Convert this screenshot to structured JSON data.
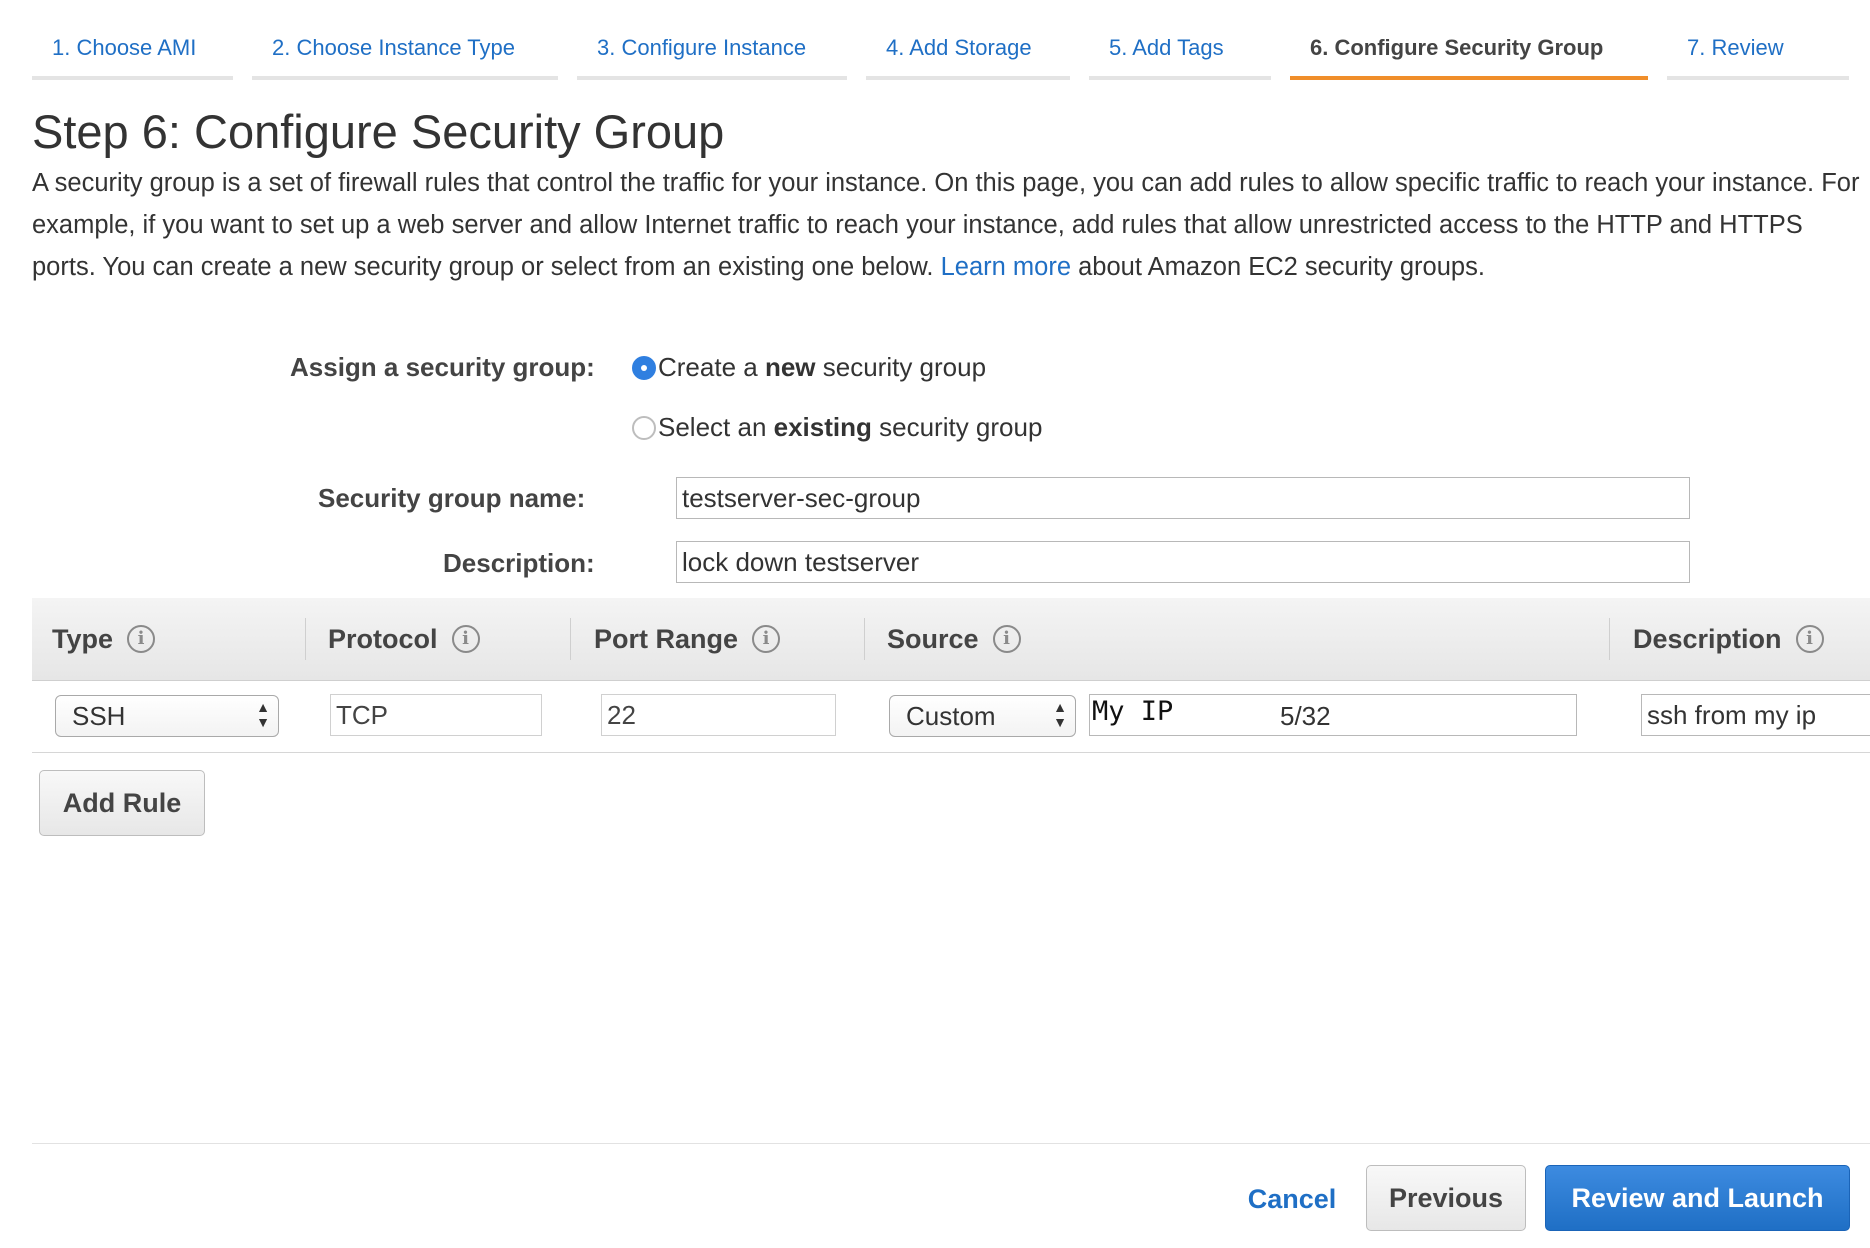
{
  "wizard": {
    "tabs": [
      {
        "label": "1. Choose AMI"
      },
      {
        "label": "2. Choose Instance Type"
      },
      {
        "label": "3. Configure Instance"
      },
      {
        "label": "4. Add Storage"
      },
      {
        "label": "5. Add Tags"
      },
      {
        "label": "6. Configure Security Group",
        "active": true
      },
      {
        "label": "7. Review"
      }
    ]
  },
  "page": {
    "title": "Step 6: Configure Security Group",
    "intro_text": "A security group is a set of firewall rules that control the traffic for your instance. On this page, you can add rules to allow specific traffic to reach your instance. For example, if you want to set up a web server and allow Internet traffic to reach your instance, add rules that allow unrestricted access to the HTTP and HTTPS ports. You can create a new security group or select from an existing one below.",
    "learn_more": "Learn more",
    "intro_suffix": "about Amazon EC2 security groups."
  },
  "form": {
    "assign_label": "Assign a security group:",
    "option_new": {
      "prefix": "Create a ",
      "bold": "new",
      "suffix": " security group",
      "selected": true
    },
    "option_existing": {
      "prefix": "Select an ",
      "bold": "existing",
      "suffix": " security group",
      "selected": false
    },
    "name_label": "Security group name:",
    "name_value": "testserver-sec-group",
    "description_label": "Description:",
    "description_value": "lock down testserver"
  },
  "rules_table": {
    "headers": {
      "type": "Type",
      "protocol": "Protocol",
      "port_range": "Port Range",
      "source": "Source",
      "description": "Description"
    },
    "info_glyph": "i",
    "rows": [
      {
        "type": "SSH",
        "protocol": "TCP",
        "port_range": "22",
        "source_mode": "Custom",
        "source_overlay": "My IP",
        "source_value": "5/32",
        "description": "ssh from my ip"
      }
    ]
  },
  "buttons": {
    "add_rule": "Add Rule",
    "cancel": "Cancel",
    "previous": "Previous",
    "review_launch": "Review and Launch"
  },
  "colors": {
    "link_blue": "#1f6fc5",
    "active_tab_orange": "#f08e2a",
    "primary_button": "#1f6fc5"
  }
}
